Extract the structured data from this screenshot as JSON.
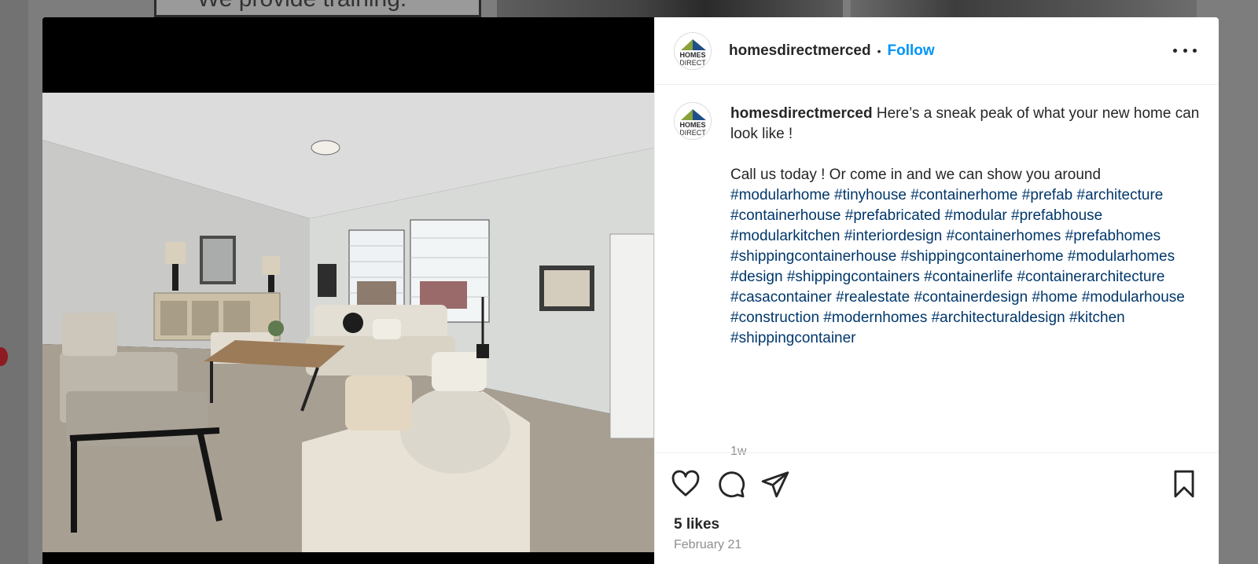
{
  "background": {
    "card_text": "We provide training."
  },
  "post": {
    "username": "homesdirectmerced",
    "avatar_logo_text": "HOMES DIRECT",
    "separator": "•",
    "follow_label": "Follow",
    "more_icon": "more-horizontal-icon",
    "caption": {
      "username": "homesdirectmerced",
      "line1": "Here’s a sneak peak of what your new home can look like !",
      "line2": "Call us today ! Or come in and we can show you around",
      "hashtags": [
        "#modularhome",
        "#tinyhouse",
        "#containerhome",
        "#prefab",
        "#architecture",
        "#containerhouse",
        "#prefabricated",
        "#modular",
        "#prefabhouse",
        "#modularkitchen",
        "#interiordesign",
        "#containerhomes",
        "#prefabhomes",
        "#shippingcontainerhouse",
        "#shippingcontainerhome",
        "#modularhomes",
        "#design",
        "#shippingcontainers",
        "#containerlife",
        "#containerarchitecture",
        "#casacontainer",
        "#realestate",
        "#containerdesign",
        "#home",
        "#modularhouse",
        "#construction",
        "#modernhomes",
        "#architecturaldesign",
        "#kitchen",
        "#shippingcontainer"
      ],
      "age": "1w"
    },
    "actions": {
      "like_icon": "heart-icon",
      "comment_icon": "comment-icon",
      "share_icon": "paper-plane-icon",
      "save_icon": "bookmark-icon"
    },
    "likes": "5 likes",
    "date": "February 21"
  },
  "colors": {
    "follow": "#0095f6",
    "hashtag": "#00376b",
    "muted": "#8e8e8e",
    "text": "#262626"
  }
}
